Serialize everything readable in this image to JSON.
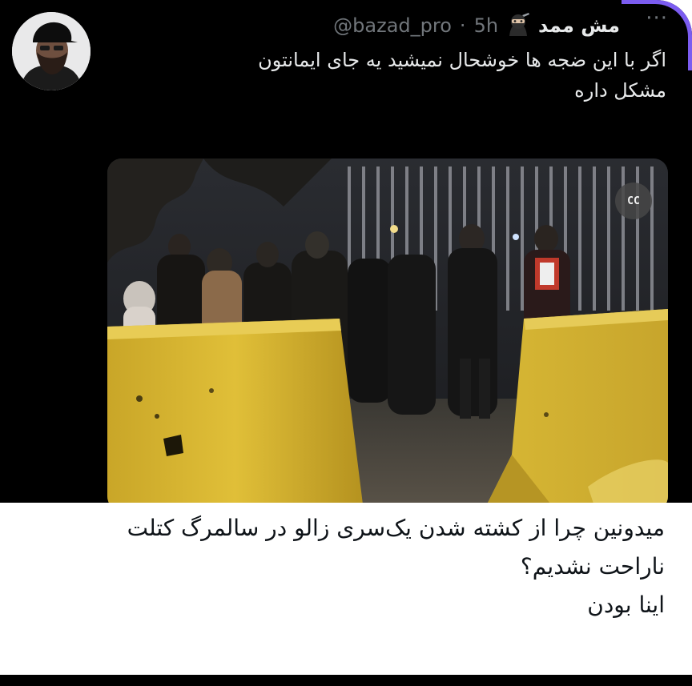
{
  "tweet": {
    "display_name": "مش ممد",
    "handle": "@bazad_pro",
    "separator": "·",
    "time": "5h",
    "more_icon": "more-horizontal-icon",
    "text_lines": [
      "اگر با این ضجه ها خوشحال نمیشید یه جای ایمانتون",
      "مشکل داره"
    ]
  },
  "media": {
    "badge_text": "CC",
    "barrier_color": "#d9b62c"
  },
  "caption": {
    "lines": [
      "میدونین چرا از کشته شدن یک‌سری زالو در سالمرگ کتلت",
      "ناراحت نشدیم؟",
      "اینا بودن"
    ]
  },
  "colors": {
    "card_bg": "#000000",
    "accent_ring": "#7b5cf0",
    "muted": "#71767b",
    "text_dark": "#e7e9ea"
  }
}
